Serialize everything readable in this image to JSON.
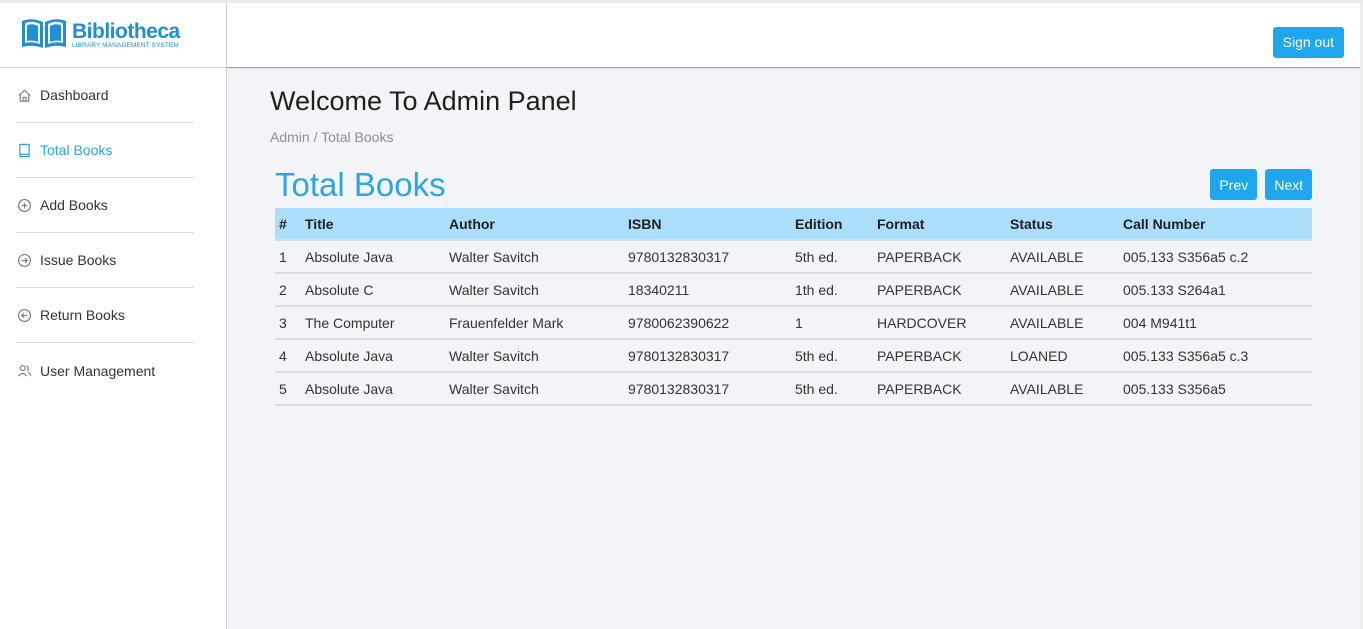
{
  "brand": {
    "name": "Bibliotheca",
    "tagline": "LIBRARY MANAGEMENT SYSTEM",
    "color": "#1e8fd8"
  },
  "header": {
    "signout_label": "Sign out"
  },
  "sidebar": {
    "items": [
      {
        "label": "Dashboard",
        "icon": "home-icon",
        "active": false
      },
      {
        "label": "Total Books",
        "icon": "book-icon",
        "active": true
      },
      {
        "label": "Add Books",
        "icon": "plus-circle-icon",
        "active": false
      },
      {
        "label": "Issue Books",
        "icon": "arrow-right-circle-icon",
        "active": false
      },
      {
        "label": "Return Books",
        "icon": "arrow-left-circle-icon",
        "active": false
      },
      {
        "label": "User Management",
        "icon": "users-icon",
        "active": false
      }
    ]
  },
  "main": {
    "title": "Welcome To Admin Panel",
    "breadcrumb": "Admin / Total Books",
    "section_title": "Total Books",
    "prev_label": "Prev",
    "next_label": "Next"
  },
  "table": {
    "columns": [
      "#",
      "Title",
      "Author",
      "ISBN",
      "Edition",
      "Format",
      "Status",
      "Call Number"
    ],
    "rows": [
      [
        "1",
        "Absolute Java",
        "Walter Savitch",
        "9780132830317",
        "5th ed.",
        "PAPERBACK",
        "AVAILABLE",
        "005.133 S356a5 c.2"
      ],
      [
        "2",
        "Absolute C",
        "Walter Savitch",
        "18340211",
        "1th ed.",
        "PAPERBACK",
        "AVAILABLE",
        "005.133 S264a1"
      ],
      [
        "3",
        "The Computer",
        "Frauenfelder Mark",
        "9780062390622",
        "1",
        "HARDCOVER",
        "AVAILABLE",
        "004 M941t1"
      ],
      [
        "4",
        "Absolute Java",
        "Walter Savitch",
        "9780132830317",
        "5th ed.",
        "PAPERBACK",
        "LOANED",
        "005.133 S356a5 c.3"
      ],
      [
        "5",
        "Absolute Java",
        "Walter Savitch",
        "9780132830317",
        "5th ed.",
        "PAPERBACK",
        "AVAILABLE",
        "005.133 S356a5"
      ]
    ]
  },
  "colors": {
    "accent": "#1ea7ee",
    "active_nav": "#29a3e3",
    "table_header": "#abdefa"
  }
}
